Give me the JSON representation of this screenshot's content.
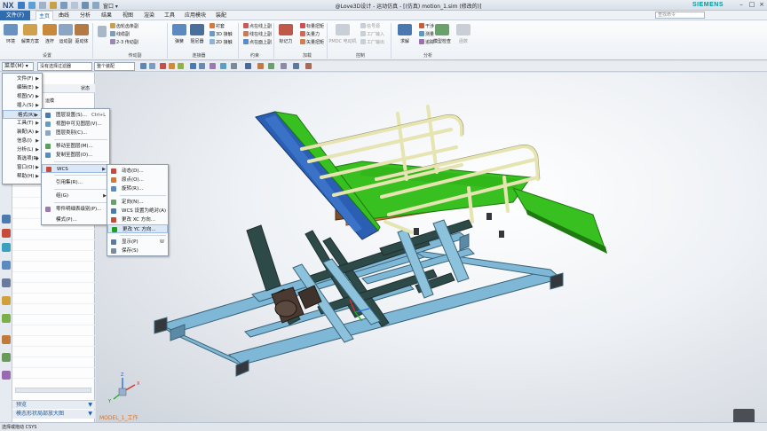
{
  "titlebar": {
    "app_logo": "NX",
    "window_menu": "窗口 ▾",
    "title": "@Love3D设计 - 运动仿真 - [(仿真) motion_1.sim  (修改的)]",
    "brand": "SIEMENS",
    "window_controls": [
      "–",
      "□",
      "×"
    ]
  },
  "ribbon": {
    "file_tab": "文件(F)",
    "tabs": [
      "主页",
      "曲线",
      "分析",
      "结果",
      "视图",
      "渲染",
      "工具",
      "应用模块",
      "装配"
    ],
    "active_tab": "主页",
    "search_placeholder": "查找命令",
    "groups": {
      "settings": {
        "label": "设置",
        "buttons": [
          "环境",
          "解算方案",
          "连杆",
          "运动副",
          "驱动体"
        ]
      },
      "drive": {
        "label": "传动副",
        "items": [
          "齿轮齿条副",
          "线缆副",
          "2-3 传动副"
        ]
      },
      "connector": {
        "label": "连接器",
        "buttons": [
          "弹簧",
          "阻尼器"
        ],
        "items": [
          "衬套",
          "3D 接触",
          "2D 接触"
        ]
      },
      "constraint": {
        "label": "约束",
        "items": [
          "点在线上副",
          "线在线上副",
          "点在面上副"
        ]
      },
      "load": {
        "label": "加载",
        "buttons": [
          "标记力"
        ],
        "items": [
          "标量扭矩",
          "矢量力",
          "矢量扭矩"
        ]
      },
      "control": {
        "label": "控制",
        "buttons": [
          "PMDC 电动机"
        ],
        "items": [
          "信号源",
          "工厂输入",
          "工厂输出"
        ]
      },
      "analysis": {
        "label": "分析",
        "buttons": [
          "求解",
          "模型检查",
          "函数"
        ],
        "items": [
          "干涉",
          "测量",
          "追踪"
        ]
      }
    }
  },
  "toolbar2": {
    "menu_button": "菜单(M) ▾",
    "filter_dropdown": "没有选择过滤器",
    "assembly_dropdown": "整个装配"
  },
  "navigator": {
    "header_status": "状态",
    "item1": "运模",
    "preview": "预览",
    "dependency": "模态形状局部放大图"
  },
  "menus": {
    "main": [
      "文件(F)",
      "编辑(E)",
      "视图(V)",
      "插入(S)",
      "格式(R)",
      "工具(T)",
      "装配(A)",
      "信息(I)",
      "分析(L)",
      "首选项(P)",
      "窗口(O)",
      "帮助(H)"
    ],
    "main_highlight": "格式(R)",
    "format": [
      {
        "label": "图层设置(S)...",
        "shortcut": "Ctrl+L"
      },
      {
        "label": "视图中可见图层(V)...",
        "shortcut": ""
      },
      {
        "label": "图层类别(C)...",
        "shortcut": ""
      },
      {
        "label": "移动至图层(M)...",
        "shortcut": ""
      },
      {
        "label": "复制至图层(O)...",
        "shortcut": ""
      },
      {
        "label": "WCS",
        "shortcut": ""
      },
      {
        "label": "引用集(R)...",
        "shortcut": ""
      },
      {
        "label": "组(G)",
        "shortcut": ""
      },
      {
        "label": "零件明细表级别(P)...",
        "shortcut": ""
      },
      {
        "label": "模式(P)...",
        "shortcut": ""
      }
    ],
    "format_highlight": "WCS",
    "wcs": [
      {
        "label": "动态(D)...",
        "shortcut": ""
      },
      {
        "label": "原点(O)...",
        "shortcut": ""
      },
      {
        "label": "旋转(R)...",
        "shortcut": ""
      },
      {
        "label": "定向(N)...",
        "shortcut": ""
      },
      {
        "label": "WCS 设置为绝对(A)",
        "shortcut": ""
      },
      {
        "label": "更改 XC 方向...",
        "shortcut": ""
      },
      {
        "label": "更改 YC 方向...",
        "shortcut": ""
      },
      {
        "label": "显示(P)",
        "shortcut": "W"
      },
      {
        "label": "保存(S)",
        "shortcut": ""
      }
    ],
    "wcs_highlight": "更改 YC 方向..."
  },
  "viewport": {
    "model_label": "MODEL_1_工作",
    "triad_labels": [
      "X",
      "Y",
      "Z"
    ]
  },
  "statusbar": {
    "text": "选择或拖动 CSYS"
  },
  "colors": {
    "file_tab": "#2f6cb0",
    "seat_green": "#38c020",
    "back_blue": "#2b5fb4",
    "frame_blue": "#7fb8d6",
    "rail_cream": "#e6e4b0",
    "dark_teal": "#2e4a48",
    "model_label": "#d0742a"
  }
}
